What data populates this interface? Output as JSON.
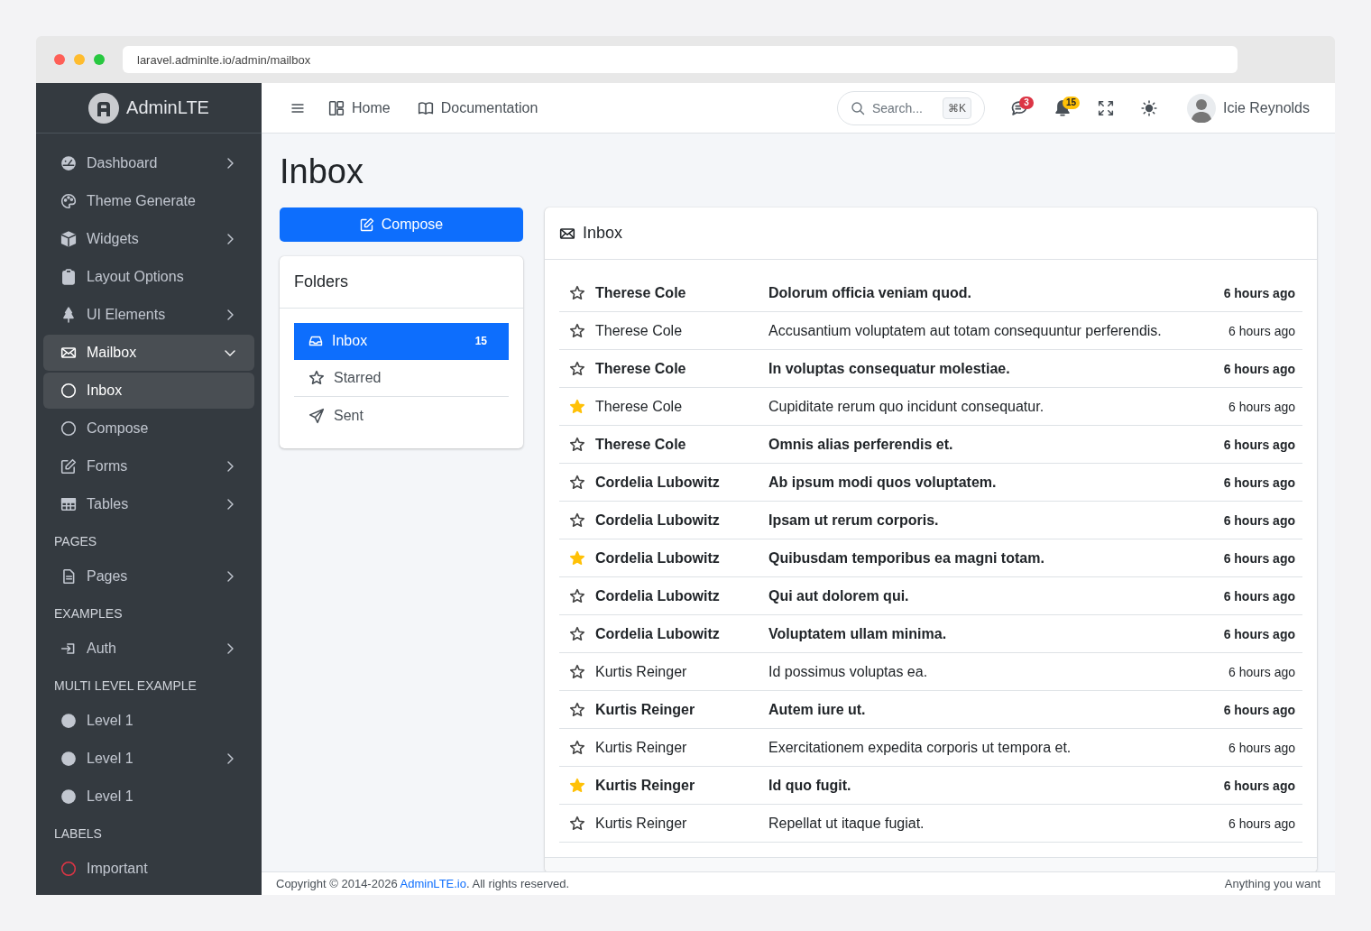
{
  "browser": {
    "url": "laravel.adminlte.io/admin/mailbox"
  },
  "brand": {
    "name": "AdminLTE"
  },
  "sidebar": {
    "items": [
      {
        "kind": "link",
        "label": "Dashboard",
        "selected": false,
        "expanded": false
      },
      {
        "kind": "link",
        "label": "Theme Generate",
        "selected": false
      },
      {
        "kind": "link",
        "label": "Widgets",
        "selected": false,
        "expanded": false
      },
      {
        "kind": "link",
        "label": "Layout Options",
        "selected": false
      },
      {
        "kind": "link",
        "label": "UI Elements",
        "selected": false,
        "expanded": false
      },
      {
        "kind": "link",
        "label": "Mailbox",
        "selected": true,
        "expanded": true,
        "children": [
          {
            "label": "Inbox",
            "selected": true
          },
          {
            "label": "Compose",
            "selected": false
          }
        ]
      },
      {
        "kind": "link",
        "label": "Forms",
        "selected": false,
        "expanded": false
      },
      {
        "kind": "link",
        "label": "Tables",
        "selected": false,
        "expanded": false
      },
      {
        "kind": "header",
        "label": "PAGES"
      },
      {
        "kind": "link",
        "label": "Pages",
        "selected": false,
        "expanded": false
      },
      {
        "kind": "header",
        "label": "EXAMPLES"
      },
      {
        "kind": "link",
        "label": "Auth",
        "selected": false,
        "expanded": false
      },
      {
        "kind": "header",
        "label": "MULTI LEVEL EXAMPLE"
      },
      {
        "kind": "dot",
        "label": "Level 1",
        "selected": false
      },
      {
        "kind": "dot",
        "label": "Level 1",
        "selected": false,
        "expanded": false
      },
      {
        "kind": "dot",
        "label": "Level 1",
        "selected": false
      },
      {
        "kind": "header",
        "label": "LABELS"
      },
      {
        "kind": "label",
        "label": "Important",
        "selected": false,
        "color": "#dc3545"
      }
    ]
  },
  "topbar": {
    "links": [
      "Home",
      "Documentation"
    ],
    "search": {
      "placeholder": "Search...",
      "shortcut": "⌘K"
    },
    "badges": [
      {
        "count": "3",
        "color": "#dc3545"
      },
      {
        "count": "15",
        "color": "#ffc107"
      }
    ],
    "user": "Icie Reynolds"
  },
  "page_title": "Inbox",
  "compose_button": "Compose",
  "folders": {
    "title": "Folders",
    "items": [
      {
        "label": "Inbox",
        "count": "15",
        "selected": true
      },
      {
        "label": "Starred",
        "selected": false
      },
      {
        "label": "Sent",
        "selected": false
      }
    ]
  },
  "mail": {
    "title": "Inbox",
    "rows": [
      {
        "sender": "Therese Cole",
        "subject": "Dolorum officia veniam quod.",
        "time": "6 hours ago",
        "starred": false,
        "unread": true
      },
      {
        "sender": "Therese Cole",
        "subject": "Accusantium voluptatem aut totam consequuntur perferendis.",
        "time": "6 hours ago",
        "starred": false,
        "unread": false
      },
      {
        "sender": "Therese Cole",
        "subject": "In voluptas consequatur molestiae.",
        "time": "6 hours ago",
        "starred": false,
        "unread": true
      },
      {
        "sender": "Therese Cole",
        "subject": "Cupiditate rerum quo incidunt consequatur.",
        "time": "6 hours ago",
        "starred": true,
        "unread": false
      },
      {
        "sender": "Therese Cole",
        "subject": "Omnis alias perferendis et.",
        "time": "6 hours ago",
        "starred": false,
        "unread": true
      },
      {
        "sender": "Cordelia Lubowitz",
        "subject": "Ab ipsum modi quos voluptatem.",
        "time": "6 hours ago",
        "starred": false,
        "unread": true
      },
      {
        "sender": "Cordelia Lubowitz",
        "subject": "Ipsam ut rerum corporis.",
        "time": "6 hours ago",
        "starred": false,
        "unread": true
      },
      {
        "sender": "Cordelia Lubowitz",
        "subject": "Quibusdam temporibus ea magni totam.",
        "time": "6 hours ago",
        "starred": true,
        "unread": true
      },
      {
        "sender": "Cordelia Lubowitz",
        "subject": "Qui aut dolorem qui.",
        "time": "6 hours ago",
        "starred": false,
        "unread": true
      },
      {
        "sender": "Cordelia Lubowitz",
        "subject": "Voluptatem ullam minima.",
        "time": "6 hours ago",
        "starred": false,
        "unread": true
      },
      {
        "sender": "Kurtis Reinger",
        "subject": "Id possimus voluptas ea.",
        "time": "6 hours ago",
        "starred": false,
        "unread": false
      },
      {
        "sender": "Kurtis Reinger",
        "subject": "Autem iure ut.",
        "time": "6 hours ago",
        "starred": false,
        "unread": true
      },
      {
        "sender": "Kurtis Reinger",
        "subject": "Exercitationem expedita corporis ut tempora et.",
        "time": "6 hours ago",
        "starred": false,
        "unread": false
      },
      {
        "sender": "Kurtis Reinger",
        "subject": "Id quo fugit.",
        "time": "6 hours ago",
        "starred": true,
        "unread": true
      },
      {
        "sender": "Kurtis Reinger",
        "subject": "Repellat ut itaque fugiat.",
        "time": "6 hours ago",
        "starred": false,
        "unread": false
      }
    ]
  },
  "footer": {
    "copyright": "Copyright © 2014-2026 **AdminLTE.io**. All rights reserved.",
    "right": "Anything you want"
  }
}
